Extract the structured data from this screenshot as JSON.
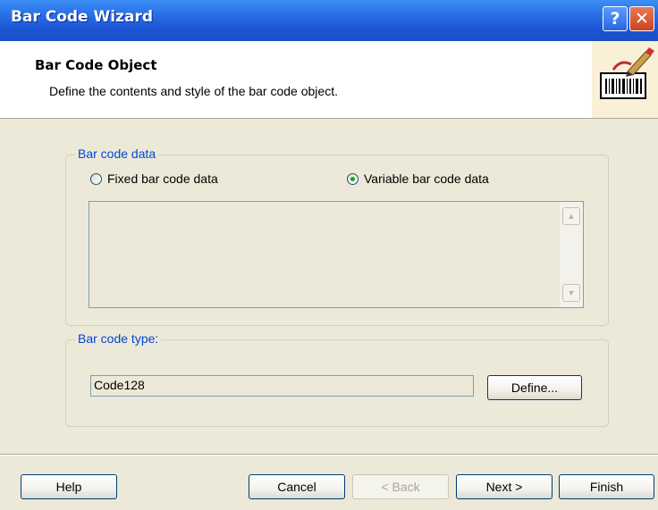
{
  "window": {
    "title": "Bar Code Wizard",
    "help_glyph": "?",
    "close_glyph": "✕"
  },
  "header": {
    "title": "Bar Code Object",
    "subtitle": "Define the contents and style of the bar code object.",
    "icon": "barcode-wizard-icon"
  },
  "bar_code_data": {
    "legend": "Bar code data",
    "options": [
      {
        "label": "Fixed bar code data",
        "selected": false
      },
      {
        "label": "Variable bar code data",
        "selected": true
      }
    ],
    "text_value": ""
  },
  "bar_code_type": {
    "legend": "Bar code type:",
    "value": "Code128",
    "define_label": "Define..."
  },
  "footer": {
    "help_label": "Help",
    "cancel_label": "Cancel",
    "back_label": "< Back",
    "next_label": "Next >",
    "finish_label": "Finish"
  },
  "colors": {
    "titlebar": "#2a6fe6",
    "group_legend": "#0046d5",
    "dialog_bg": "#ece9d8"
  }
}
